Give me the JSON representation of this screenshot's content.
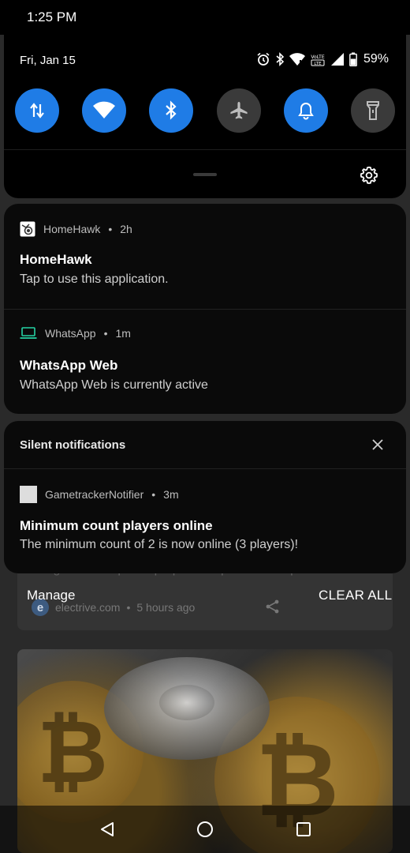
{
  "status_bar": {
    "time": "1:25 PM"
  },
  "quick_settings": {
    "date": "Fri, Jan 15",
    "battery_percent": "59%",
    "status_icons": [
      "alarm-icon",
      "bluetooth-icon",
      "wifi-icon",
      "volte-lte-icon",
      "cell-signal-icon",
      "battery-icon"
    ],
    "tiles": [
      {
        "name": "mobile-data",
        "icon": "data-transfer-icon",
        "state": "on"
      },
      {
        "name": "wifi",
        "icon": "wifi-icon",
        "state": "on"
      },
      {
        "name": "bluetooth",
        "icon": "bluetooth-icon",
        "state": "on"
      },
      {
        "name": "airplane-mode",
        "icon": "airplane-icon",
        "state": "off"
      },
      {
        "name": "sound",
        "icon": "bell-icon",
        "state": "on"
      },
      {
        "name": "flashlight",
        "icon": "flashlight-icon",
        "state": "off"
      }
    ],
    "colors": {
      "tile_on": "#1f7ce6",
      "tile_off": "#3a3a3a"
    }
  },
  "notifications": [
    {
      "app": "HomeHawk",
      "time": "2h",
      "title": "HomeHawk",
      "text": "Tap to use this application."
    },
    {
      "app": "WhatsApp",
      "time": "1m",
      "title": "WhatsApp Web",
      "text": "WhatsApp Web is currently active"
    }
  ],
  "silent_notifications": {
    "label": "Silent notifications",
    "items": [
      {
        "app": "GametrackerNotifier",
        "time": "3m",
        "title": "Minimum count players online",
        "text": "The minimum count of 2 is now online (3 players)!"
      }
    ]
  },
  "actions": {
    "manage": "Manage",
    "clear_all": "CLEAR ALL"
  },
  "background": {
    "snippet": "merger with a special purpose acquisition compan...",
    "source": "electrive.com",
    "age": "5 hours ago"
  },
  "nav": {
    "buttons": [
      "back-icon",
      "home-icon",
      "recents-icon"
    ]
  }
}
